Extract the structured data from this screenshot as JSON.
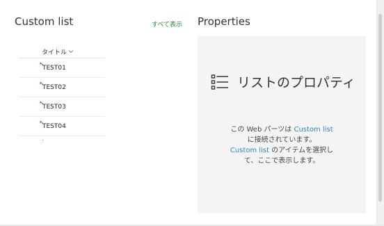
{
  "list_part": {
    "title": "Custom list",
    "see_all": "すべて表示",
    "column_header": "タイトル",
    "rows": [
      "TEST01",
      "TEST02",
      "TEST03",
      "TEST04"
    ]
  },
  "properties_part": {
    "heading": "Properties",
    "panel_title": "リストのプロパティ",
    "message": {
      "line1_prefix": "この Web パーツは ",
      "line1_link": "Custom list",
      "line2": "に接続されています。",
      "line3_link": "Custom list",
      "line3_suffix": " のアイテムを選択し",
      "line4": "て、ここで表示します。"
    }
  },
  "colors": {
    "accent_link": "#2b88b8",
    "see_all": "#2e8b3a",
    "panel_bg": "#f4f4f4",
    "new_item_marker": "#2e8b3a"
  },
  "icons": {
    "column_sort": "chevron-down-icon",
    "new_item": "new-item-icon",
    "properties": "list-icon"
  }
}
